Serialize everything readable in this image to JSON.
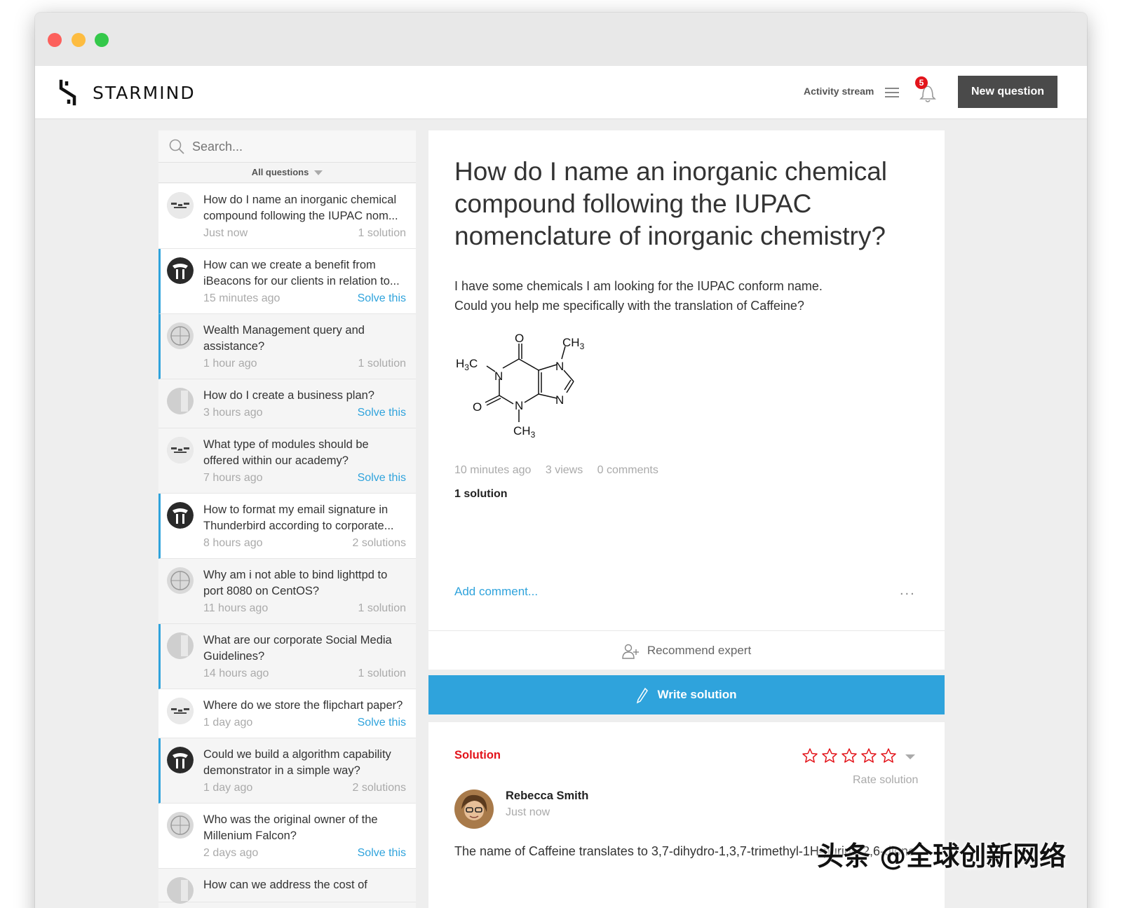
{
  "app": {
    "logo_text": "STARMIND",
    "activity_label": "Activity stream",
    "notification_count": "5",
    "new_question_label": "New question",
    "accent_color": "#2fa3dc",
    "alert_color": "#e3141b"
  },
  "sidebar": {
    "search_placeholder": "Search...",
    "filter_label": "All questions",
    "items": [
      {
        "title": "How do I name an inorganic chemical compound following the IUPAC nom...",
        "time": "Just now",
        "status": "1 solution",
        "solve": false,
        "flag": false,
        "alt": false
      },
      {
        "title": "How can we create a benefit from iBeacons for our clients in relation to...",
        "time": "15 minutes ago",
        "status": "Solve this",
        "solve": true,
        "flag": true,
        "alt": false
      },
      {
        "title": "Wealth Management query and assistance?",
        "time": "1 hour ago",
        "status": "1 solution",
        "solve": false,
        "flag": true,
        "alt": true
      },
      {
        "title": "How do I create a business plan?",
        "time": "3 hours ago",
        "status": "Solve this",
        "solve": true,
        "flag": false,
        "alt": true
      },
      {
        "title": "What type of modules should be offered within our academy?",
        "time": "7 hours ago",
        "status": "Solve this",
        "solve": true,
        "flag": false,
        "alt": true
      },
      {
        "title": "How to format my email signature in Thunderbird according to corporate...",
        "time": "8 hours ago",
        "status": "2 solutions",
        "solve": false,
        "flag": true,
        "alt": false
      },
      {
        "title": "Why am i not able to bind lighttpd to port 8080 on CentOS?",
        "time": "11 hours ago",
        "status": "1 solution",
        "solve": false,
        "flag": false,
        "alt": true
      },
      {
        "title": "What are our corporate Social Media Guidelines?",
        "time": "14 hours ago",
        "status": "1 solution",
        "solve": false,
        "flag": true,
        "alt": true
      },
      {
        "title": "Where do we store the flipchart paper?",
        "time": "1 day ago",
        "status": "Solve this",
        "solve": true,
        "flag": false,
        "alt": false
      },
      {
        "title": "Could we build a algorithm capability demonstrator in a simple way?",
        "time": "1 day ago",
        "status": "2 solutions",
        "solve": false,
        "flag": true,
        "alt": true
      },
      {
        "title": "Who was the original owner of the Millenium Falcon?",
        "time": "2 days ago",
        "status": "Solve this",
        "solve": true,
        "flag": false,
        "alt": false
      },
      {
        "title": "How can we address the cost of",
        "time": "",
        "status": "",
        "solve": false,
        "flag": false,
        "alt": true
      }
    ]
  },
  "question": {
    "title": "How do I name an inorganic chemical compound following the IUPAC nomenclature of inorganic chemistry?",
    "body_line1": "I have some chemicals I am looking for the IUPAC conform name.",
    "body_line2": "Could you help me specifically with the translation of Caffeine?",
    "time": "10 minutes ago",
    "views": "3 views",
    "comments": "0 comments",
    "solutions": "1 solution",
    "add_comment": "Add comment...",
    "more": "...",
    "recommend_label": "Recommend expert",
    "write_label": "Write solution",
    "molecule_labels": {
      "o_top": "O",
      "o_left": "O",
      "ch3_top": "CH3",
      "h3c": "H3C",
      "ch3_bottom": "CH3",
      "n": "N"
    }
  },
  "solution": {
    "label": "Solution",
    "rate_label": "Rate solution",
    "rating": 0,
    "rating_max": 5,
    "author": "Rebecca Smith",
    "time": "Just now",
    "body": "The name of Caffeine translates to 3,7-dihydro-1,3,7-trimethyl-1H-purine-2,6-dione."
  },
  "watermark": "头条 @全球创新网络"
}
